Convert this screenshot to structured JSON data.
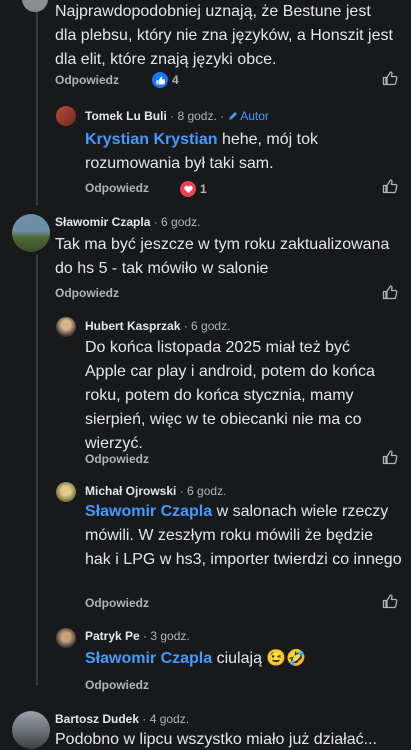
{
  "comments": [
    {
      "id": "c0",
      "text": "Najprawdopodobniej uznają, że Bestune jest dla plebsu, który nie zna języków, a Honszit jest dla elit, które znają języki obce.",
      "reply_label": "Odpowiedz",
      "reaction_count": "4",
      "reaction_icon": "like-icon"
    },
    {
      "id": "c1",
      "author": "Tomek Lu Buli",
      "time": "· 8 godz.",
      "author_badge": "Autor",
      "mention": "Krystian Krystian",
      "text": " hehe, mój tok rozumowania był taki sam.",
      "reply_label": "Odpowiedz",
      "reaction_count": "1",
      "reaction_icon": "love-icon"
    },
    {
      "id": "c2",
      "author": "Sławomir Czapla",
      "time": "· 6 godz.",
      "text": "Tak ma być jeszcze w tym roku zaktualizowana do hs 5 - tak mówiło w salonie",
      "reply_label": "Odpowiedz"
    },
    {
      "id": "c3",
      "author": "Hubert Kasprzak",
      "time": "· 6 godz.",
      "text": "Do końca listopada 2025 miał też być Apple car play i android, potem do końca roku, potem do końca stycznia, mamy sierpień, więc w te obiecanki nie ma co wierzyć.",
      "reply_label": "Odpowiedz"
    },
    {
      "id": "c4",
      "author": "Michał Ojrowski",
      "time": "· 6 godz.",
      "mention": "Sławomir Czapla",
      "text": " w salonach wiele rzeczy mówili. W zeszłym roku mówili że będzie hak i LPG w hs3, importer twierdzi co innego",
      "reply_label": "Odpowiedz"
    },
    {
      "id": "c5",
      "author": "Patryk Pe",
      "time": "· 3 godz.",
      "mention": "Sławomir Czapla",
      "text": " ciulają 😉🤣",
      "reply_label": "Odpowiedz"
    },
    {
      "id": "c6",
      "author": "Bartosz Dudek",
      "time": "· 4 godz.",
      "text": "Podobno w lipcu wszystko miało już działać..."
    }
  ],
  "colors": {
    "background": "#18191a",
    "text": "#e4e6eb",
    "secondary": "#b0b3b8",
    "link": "#4599ff",
    "like": "#1877f2",
    "love": "#f33e58"
  }
}
